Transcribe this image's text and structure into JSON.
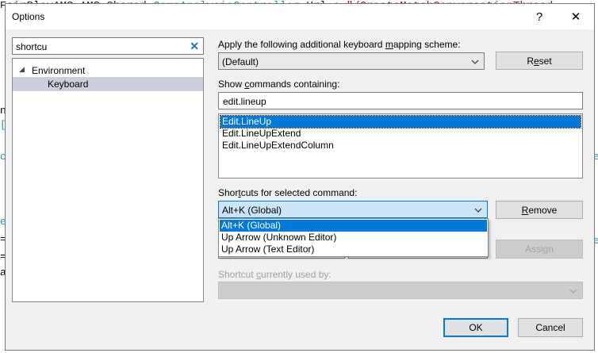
{
  "background": {
    "code_fragments": [
      "EairPlayAMS.AMS.Shared.",
      "GameAnalysisController",
      " Url : ",
      "\"/CreateMatchConversationThread"
    ],
    "left_bleed": [
      "nk",
      "[",
      "ce",
      "er",
      "=",
      "=",
      "al"
    ],
    "right_bleed": [
      "e",
      "e"
    ]
  },
  "dialog": {
    "title": "Options",
    "help_glyph": "?",
    "close_glyph": "✕"
  },
  "left": {
    "search_value": "shortcu",
    "clear_glyph": "✕",
    "tree": [
      {
        "label": "Environment",
        "expanded": true
      },
      {
        "label": "Keyboard",
        "selected": true
      }
    ]
  },
  "right": {
    "mapping_label_pre": "Apply the following additional keyboard ",
    "mapping_label_u": "m",
    "mapping_label_post": "apping scheme:",
    "mapping_value": "(Default)",
    "reset_pre": "R",
    "reset_u": "e",
    "reset_post": "set",
    "show_label_pre": "Show ",
    "show_label_u": "c",
    "show_label_post": "ommands containing:",
    "filter_value": "edit.lineup",
    "commands": [
      "Edit.LineUp",
      "Edit.LineUpExtend",
      "Edit.LineUpExtendColumn"
    ],
    "shortcuts_label_pre": "Shor",
    "shortcuts_label_u": "t",
    "shortcuts_label_post": "cuts for selected command:",
    "shortcut_value": "Alt+K (Global)",
    "remove_u": "R",
    "remove_post": "emove",
    "shortcut_options": [
      "Alt+K (Global)",
      "Up Arrow (Unknown Editor)",
      "Up Arrow (Text Editor)"
    ],
    "assign_label": "Assign",
    "used_by_pre": "Shortcut ",
    "used_by_u": "c",
    "used_by_post": "urrently used by:"
  },
  "footer": {
    "ok_label": "OK",
    "cancel_label": "Cancel"
  },
  "colors": {
    "accent": "#0078d7",
    "dialog_bg": "#f0f0f0",
    "tree_selection": "#cccedb"
  }
}
